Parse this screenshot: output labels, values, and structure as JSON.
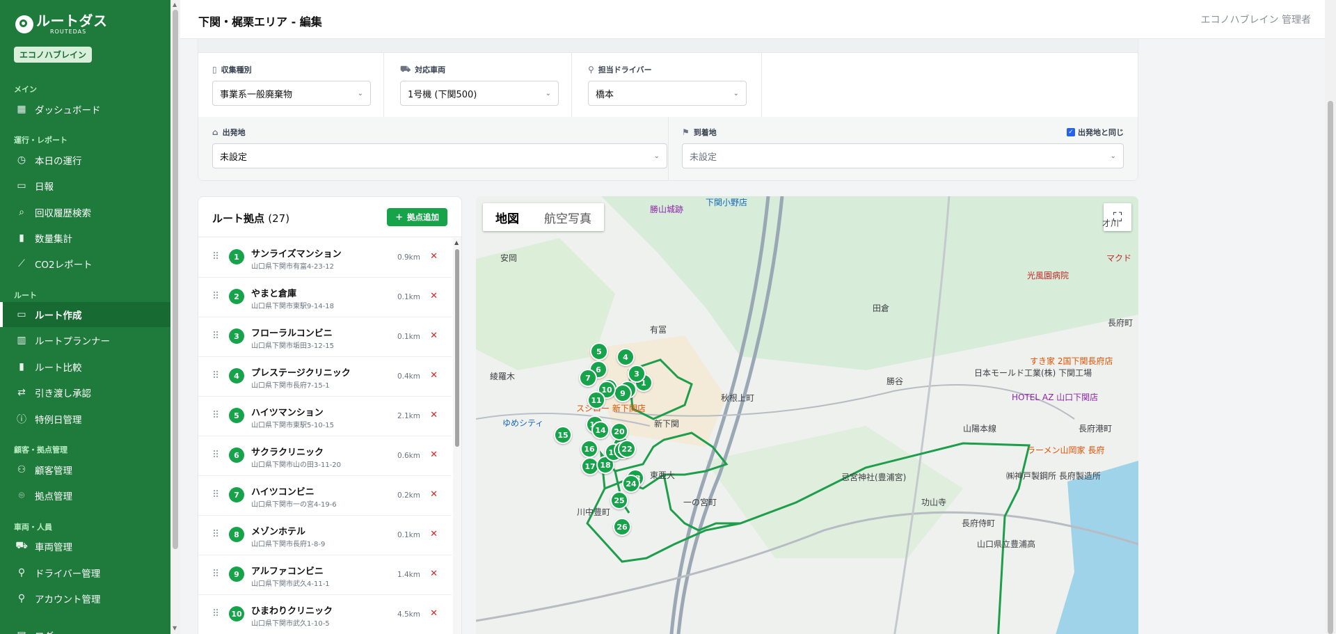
{
  "app": {
    "logo_title": "ルートダス",
    "logo_sub": "ROUTEDAS",
    "org": "エコノハブレイン"
  },
  "sidebar": {
    "sections": [
      {
        "label": "メイン"
      },
      {
        "label": "運行・レポート"
      },
      {
        "label": "ルート"
      },
      {
        "label": "顧客・拠点管理"
      },
      {
        "label": "車両・人員"
      }
    ],
    "items": [
      {
        "label": "ダッシュボード",
        "icon": "grid-icon"
      },
      {
        "label": "本日の運行",
        "icon": "clock-icon"
      },
      {
        "label": "日報",
        "icon": "document-icon"
      },
      {
        "label": "回収履歴検索",
        "icon": "search-icon"
      },
      {
        "label": "数量集計",
        "icon": "bar-chart-icon"
      },
      {
        "label": "CO2レポート",
        "icon": "trend-icon"
      },
      {
        "label": "ルート作成",
        "icon": "document-icon"
      },
      {
        "label": "ルートプランナー",
        "icon": "map-icon"
      },
      {
        "label": "ルート比較",
        "icon": "bar-chart-icon"
      },
      {
        "label": "引き渡し承認",
        "icon": "swap-icon"
      },
      {
        "label": "特例日管理",
        "icon": "info-circle-icon"
      },
      {
        "label": "顧客管理",
        "icon": "users-icon"
      },
      {
        "label": "拠点管理",
        "icon": "map-pin-icon"
      },
      {
        "label": "車両管理",
        "icon": "truck-icon"
      },
      {
        "label": "ドライバー管理",
        "icon": "user-icon"
      },
      {
        "label": "アカウント管理",
        "icon": "user-icon"
      },
      {
        "label": "ログ",
        "icon": "log-icon"
      }
    ]
  },
  "header": {
    "title": "下関・梶栗エリア - 編集",
    "user": "エコノハブレイン 管理者"
  },
  "form": {
    "collection_type": {
      "label": "収集種別",
      "value": "事業系一般廃棄物"
    },
    "vehicle": {
      "label": "対応車両",
      "value": "1号機 (下関500)"
    },
    "driver": {
      "label": "担当ドライバー",
      "value": "橋本"
    },
    "origin": {
      "label": "出発地",
      "value": "未設定"
    },
    "destination": {
      "label": "到着地",
      "value": "未設定"
    },
    "same_as_origin": {
      "label": "出発地と同じ",
      "checked": true
    }
  },
  "route_panel": {
    "title": "ルート拠点",
    "count": "(27)",
    "add_label": "拠点追加",
    "points": [
      {
        "no": "1",
        "name": "サンライズマンション",
        "address": "山口県下関市有富4-23-12",
        "distance": "0.9km"
      },
      {
        "no": "2",
        "name": "やまと倉庫",
        "address": "山口県下関市東駅9-14-18",
        "distance": "0.1km"
      },
      {
        "no": "3",
        "name": "フローラルコンビニ",
        "address": "山口県下関市垢田3-12-15",
        "distance": "0.1km"
      },
      {
        "no": "4",
        "name": "プレステージクリニック",
        "address": "山口県下関市長府7-15-1",
        "distance": "0.4km"
      },
      {
        "no": "5",
        "name": "ハイツマンション",
        "address": "山口県下関市東駅5-10-15",
        "distance": "2.1km"
      },
      {
        "no": "6",
        "name": "サクラクリニック",
        "address": "山口県下関市山の田3-11-20",
        "distance": "0.6km"
      },
      {
        "no": "7",
        "name": "ハイツコンビニ",
        "address": "山口県下関市一の宮4-19-6",
        "distance": "0.2km"
      },
      {
        "no": "8",
        "name": "メゾンホテル",
        "address": "山口県下関市長府1-8-9",
        "distance": "0.1km"
      },
      {
        "no": "9",
        "name": "アルファコンビニ",
        "address": "山口県下関市武久4-11-1",
        "distance": "1.4km"
      },
      {
        "no": "10",
        "name": "ひまわりクリニック",
        "address": "山口県下関市武久1-10-5",
        "distance": "4.5km"
      }
    ]
  },
  "map": {
    "tab_map": "地図",
    "tab_aerial": "航空写真",
    "labels": [
      {
        "text": "下関小野店",
        "cls": "poi-blue"
      },
      {
        "text": "勝山城跡",
        "cls": "poi"
      },
      {
        "text": "才川",
        "cls": ""
      },
      {
        "text": "マクド",
        "cls": "poi-red"
      },
      {
        "text": "安岡",
        "cls": ""
      },
      {
        "text": "光風園病院",
        "cls": "poi-red"
      },
      {
        "text": "田倉",
        "cls": ""
      },
      {
        "text": "有冨",
        "cls": ""
      },
      {
        "text": "長府町",
        "cls": ""
      },
      {
        "text": "すき家 2国下関長府店",
        "cls": "poi-orange"
      },
      {
        "text": "綾羅木",
        "cls": ""
      },
      {
        "text": "勝谷",
        "cls": ""
      },
      {
        "text": "日本モールド工業(株) 下関工場",
        "cls": ""
      },
      {
        "text": "秋根上町",
        "cls": ""
      },
      {
        "text": "HOTEL AZ 山口下関店",
        "cls": "poi"
      },
      {
        "text": "ゆめシティ",
        "cls": "poi-blue"
      },
      {
        "text": "新下関",
        "cls": ""
      },
      {
        "text": "ラーメン山岡家 長府",
        "cls": "poi-orange"
      },
      {
        "text": "東亜大",
        "cls": ""
      },
      {
        "text": "忌宮神社(豊浦宮)",
        "cls": ""
      },
      {
        "text": "功山寺",
        "cls": ""
      },
      {
        "text": "一の宮町",
        "cls": ""
      },
      {
        "text": "川中豊町",
        "cls": ""
      },
      {
        "text": "長府侍町",
        "cls": ""
      },
      {
        "text": "山口県立豊浦高",
        "cls": ""
      },
      {
        "text": "山陽本線",
        "cls": ""
      },
      {
        "text": "長府港町",
        "cls": ""
      },
      {
        "text": "㈱神戸製鋼所 長府製造所",
        "cls": ""
      },
      {
        "text": "スシロー 新下関店",
        "cls": "poi-orange"
      }
    ],
    "pins": [
      "1",
      "2",
      "3",
      "4",
      "5",
      "6",
      "7",
      "8",
      "9",
      "10",
      "11",
      "12",
      "13",
      "14",
      "15",
      "16",
      "17",
      "18",
      "19",
      "20",
      "21",
      "22",
      "23",
      "24",
      "25",
      "26"
    ]
  }
}
